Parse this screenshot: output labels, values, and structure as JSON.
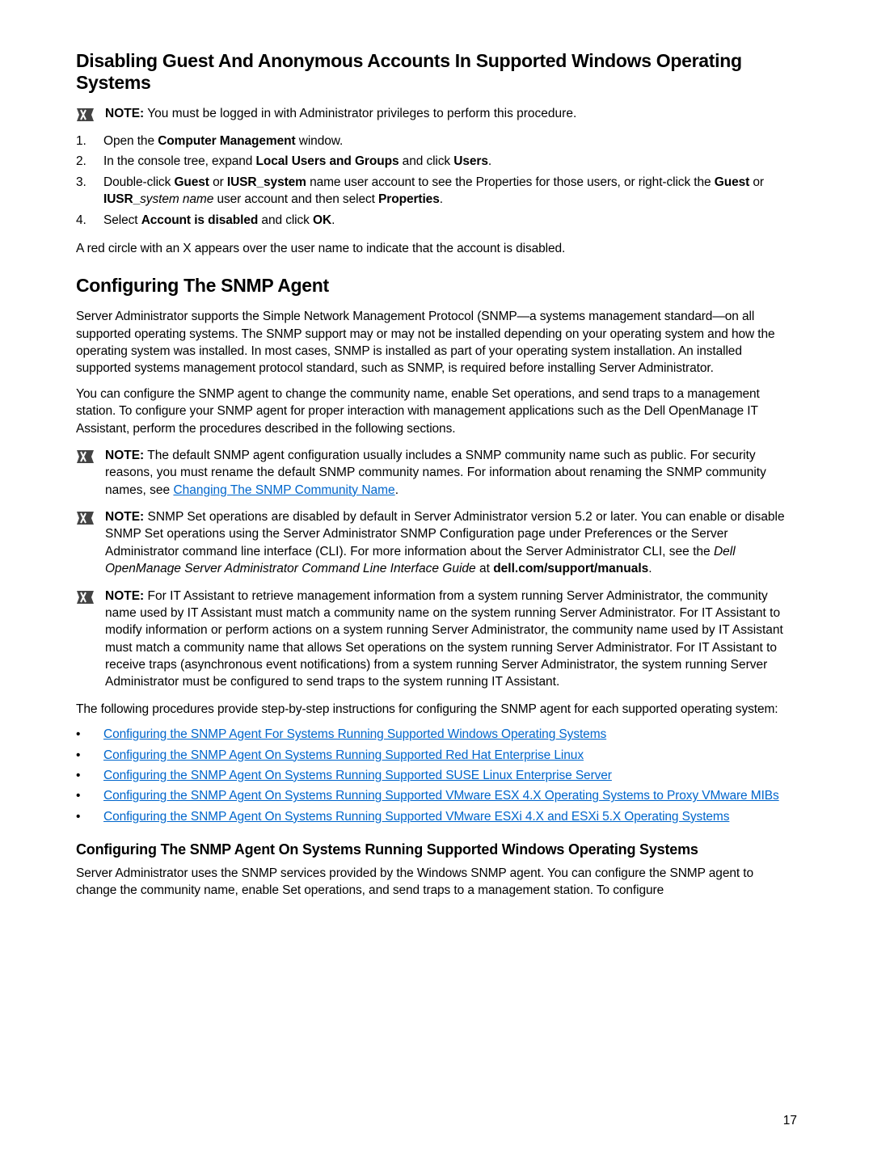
{
  "section1": {
    "title": "Disabling Guest And Anonymous Accounts In Supported Windows Operating Systems",
    "note1": {
      "label": "NOTE:",
      "text": " You must be logged in with Administrator privileges to perform this procedure."
    },
    "steps": [
      {
        "num": "1.",
        "before": "Open the ",
        "bold1": "Computer Management",
        "after1": " window."
      },
      {
        "num": "2.",
        "before": "In the console tree, expand ",
        "bold1": "Local Users and Groups",
        "mid1": " and click ",
        "bold2": "Users",
        "after2": "."
      },
      {
        "num": "3.",
        "before": "Double-click ",
        "bold1": "Guest",
        "mid1": " or ",
        "bold2": "IUSR_system",
        "mid2": " name user account to see the Properties for those users, or right-click the ",
        "bold3": "Guest",
        "mid3": " or ",
        "bold4": "IUSR_",
        "italic1": "system name",
        "mid4": " user account and then select ",
        "bold5": "Properties",
        "after5": "."
      },
      {
        "num": "4.",
        "before": "Select ",
        "bold1": "Account is disabled",
        "mid1": " and click ",
        "bold2": "OK",
        "after2": "."
      }
    ],
    "closing": "A red circle with an X appears over the user name to indicate that the account is disabled."
  },
  "section2": {
    "title": "Configuring The SNMP Agent",
    "para1": "Server Administrator supports the Simple Network Management Protocol (SNMP—a systems management standard—on all supported operating systems. The SNMP support may or may not be installed depending on your operating system and how the operating system was installed. In most cases, SNMP is installed as part of your operating system installation. An installed supported systems management protocol standard, such as SNMP, is required before installing Server Administrator.",
    "para2": "You can configure the SNMP agent to change the community name, enable Set operations, and send traps to a management station. To configure your SNMP agent for proper interaction with management applications such as the Dell OpenManage IT Assistant, perform the procedures described in the following sections.",
    "note1": {
      "label": "NOTE:",
      "text_a": " The default SNMP agent configuration usually includes a SNMP community name such as public. For security reasons, you must rename the default SNMP community names. For information about renaming the SNMP community names, see ",
      "link": "Changing The SNMP Community Name",
      "text_b": "."
    },
    "note2": {
      "label": "NOTE:",
      "text_a": " SNMP Set operations are disabled by default in Server Administrator version 5.2 or later. You can enable or disable SNMP Set operations using the Server Administrator SNMP Configuration page under Preferences or the Server Administrator command line interface (CLI). For more information about the Server Administrator CLI, see the ",
      "italic": "Dell OpenManage Server Administrator Command Line Interface Guide",
      "text_b": " at ",
      "bold": "dell.com/support/manuals",
      "text_c": "."
    },
    "note3": {
      "label": "NOTE:",
      "text": " For IT Assistant to retrieve management information from a system running Server Administrator, the community name used by IT Assistant must match a community name on the system running Server Administrator. For IT Assistant to modify information or perform actions on a system running Server Administrator, the community name used by IT Assistant must match a community name that allows Set operations on the system running Server Administrator. For IT Assistant to receive traps (asynchronous event notifications) from a system running Server Administrator, the system running Server Administrator must be configured to send traps to the system running IT Assistant."
    },
    "para3": "The following procedures provide step-by-step instructions for configuring the SNMP agent for each supported operating system:",
    "bullets": [
      {
        "link": "Configuring the SNMP Agent For Systems Running Supported Windows Operating Systems"
      },
      {
        "link": "Configuring the SNMP Agent On Systems Running Supported Red Hat Enterprise Linux"
      },
      {
        "link": "Configuring the SNMP Agent On Systems Running Supported SUSE Linux Enterprise Server"
      },
      {
        "link": "Configuring the SNMP Agent On Systems Running Supported VMware ESX 4.X Operating Systems to Proxy VMware MIBs"
      },
      {
        "link": "Configuring the SNMP Agent On Systems Running Supported VMware ESXi 4.X and ESXi 5.X Operating Systems"
      }
    ],
    "sub": {
      "title": "Configuring The SNMP Agent On Systems Running Supported Windows Operating Systems",
      "para": "Server Administrator uses the SNMP services provided by the Windows SNMP agent. You can configure the SNMP agent to change the community name, enable Set operations, and send traps to a management station. To configure"
    }
  },
  "pagenum": "17",
  "glyphs": {
    "bullet": "•"
  }
}
